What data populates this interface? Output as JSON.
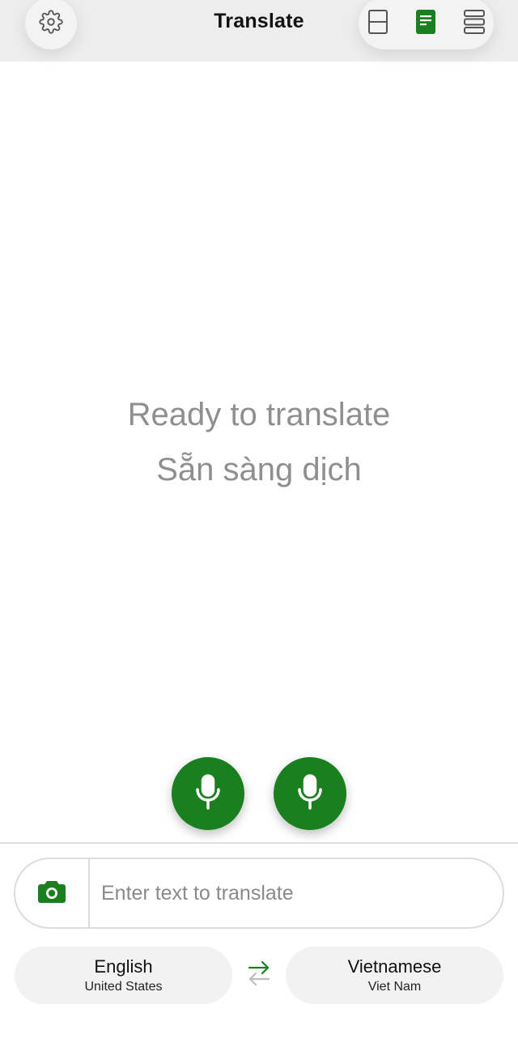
{
  "header": {
    "title": "Translate",
    "settings_icon": "gear-icon",
    "view_modes": [
      {
        "name": "split-view",
        "icon": "split-layout-icon",
        "active": false
      },
      {
        "name": "document-view",
        "icon": "document-icon",
        "active": true
      },
      {
        "name": "list-view",
        "icon": "stacked-list-icon",
        "active": false
      }
    ]
  },
  "main": {
    "status_source": "Ready to translate",
    "status_target": "Sẵn sàng dịch"
  },
  "mic_buttons": [
    {
      "language": "English",
      "icon": "microphone-icon"
    },
    {
      "language": "Vietnamese",
      "icon": "microphone-icon"
    }
  ],
  "input": {
    "placeholder": "Enter text to translate",
    "value": "",
    "camera_icon": "camera-icon"
  },
  "languages": {
    "source": {
      "name": "English",
      "region": "United States"
    },
    "target": {
      "name": "Vietnamese",
      "region": "Viet Nam"
    },
    "swap_icon": "swap-arrows-icon"
  },
  "colors": {
    "accent": "#1a7f1e",
    "header_bg": "#ededed",
    "status_text": "#8f8f8f"
  }
}
